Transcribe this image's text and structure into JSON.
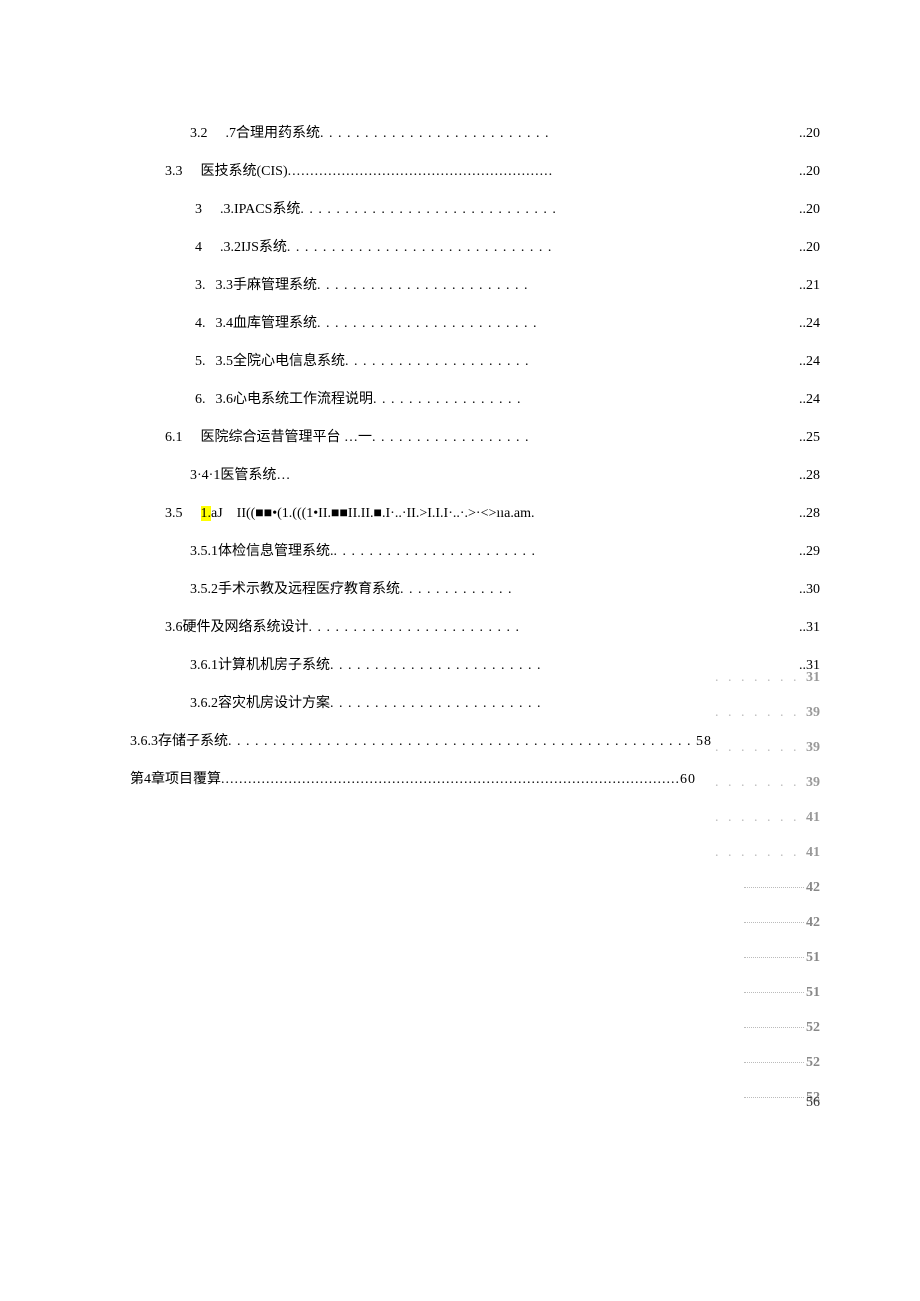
{
  "toc": [
    {
      "indent": "indent-2",
      "prefix": "3.2",
      "prefixClass": "gap-prefix-wide",
      "title": ".7合理用药系统",
      "dots": ". . . . . . . . . . . . . . . . . . . . . . . . . .",
      "page": "..20",
      "highlight": false
    },
    {
      "indent": "indent-1",
      "prefix": "3.3",
      "prefixClass": "gap-prefix-wide",
      "title": "医技系统(CIS)",
      "dots": "...........................................................",
      "page": "..20",
      "highlight": false
    },
    {
      "indent": "indent-2b",
      "prefix": "3",
      "prefixClass": "gap-prefix-wide",
      "title": ".3.IPACS系统 ",
      "dots": ". . . . . . . . . . . . . . . . . . . . . . . . . . . . .",
      "page": "..20",
      "highlight": false
    },
    {
      "indent": "indent-2b",
      "prefix": "4",
      "prefixClass": "gap-prefix-wide",
      "title": ".3.2IJS系统 ",
      "dots": ". . . . . . . . . . . . . . . . . . . . . . . . . . . . . .",
      "page": "..20",
      "highlight": false
    },
    {
      "indent": "indent-2b",
      "prefix": "3.",
      "prefixClass": "num-prefix",
      "title": "3.3手麻管理系统 ",
      "dots": ". . . . . . . . . . . . . . . . . . . . . . . .",
      "page": "..21",
      "highlight": false
    },
    {
      "indent": "indent-2b",
      "prefix": "4.",
      "prefixClass": "num-prefix",
      "title": "3.4血库管理系统 ",
      "dots": ". . . . . . . . . . . . . . . . . . . . . . . . .",
      "page": "..24",
      "highlight": false
    },
    {
      "indent": "indent-2b",
      "prefix": "5.",
      "prefixClass": "num-prefix",
      "title": "3.5全院心电信息系统 ",
      "dots": ". . . . . . . . . . . . . . . . . . . . .",
      "page": "..24",
      "highlight": false
    },
    {
      "indent": "indent-2b",
      "prefix": "6.",
      "prefixClass": "num-prefix",
      "title": "3.6心电系统工作流程说明 ",
      "dots": ". . . . . . . . . . . . . . . . .",
      "page": "..24",
      "highlight": false
    },
    {
      "indent": "indent-1",
      "prefix": "6.1",
      "prefixClass": "gap-prefix-wide",
      "title": "医院综合运昔管理平台 …一 ",
      "dots": ". . . . . . . . . .  . . . . . . . .",
      "page": "..25",
      "highlight": false
    },
    {
      "indent": "indent-2",
      "prefix": "",
      "prefixClass": "",
      "title": "3·4·1医管系统…",
      "dots": "",
      "page": "..28",
      "highlight": false
    },
    {
      "indent": "indent-1",
      "prefix": "3.5",
      "prefixClass": "gap-prefix-wide",
      "title": "aJ　II((■■•(1.(((1•II.■■II.II.■.I·..·II.>I.I.I·..·.>·<>ııa.am.",
      "dots": "",
      "page": "..28",
      "highlight": true,
      "highlightText": "1."
    },
    {
      "indent": "indent-2",
      "prefix": "",
      "prefixClass": "",
      "title": "3.5.1体检信息管理系统. ",
      "dots": ". . . . . . . . . . . . . . . .  . . . . . .  .",
      "page": "..29",
      "highlight": false
    },
    {
      "indent": "indent-2",
      "prefix": "",
      "prefixClass": "",
      "title": "3.5.2手术示教及远程医疗教育系统 ",
      "dots": ". . . . . . . . . . . . .",
      "page": "..30",
      "highlight": false
    },
    {
      "indent": "indent-1",
      "prefix": "",
      "prefixClass": "",
      "title": "3.6硬件及网络系统设计 ",
      "dots": ". . . . . . . . . . . . . . . . . . . . . . . .",
      "page": "..31",
      "highlight": false
    },
    {
      "indent": "indent-2",
      "prefix": "",
      "prefixClass": "",
      "title": "3.6.1计算机机房子系统 ",
      "dots": ". . . . . . . . . . . . . . . . . . . . . . . .",
      "page": "..31",
      "highlight": false
    },
    {
      "indent": "indent-2",
      "prefix": "",
      "prefixClass": "",
      "title": "3.6.2容灾机房设计方案 ",
      "dots": ". . . . . . . . . . . . . . . . . . . . . . . .",
      "page": "",
      "highlight": false
    },
    {
      "indent": "indent-0",
      "prefix": "",
      "prefixClass": "",
      "title": "3.6.3存储子系统 ",
      "dots": ". . . . . . . . . . . . . . . . . . . . . . . . . . . . . . . . . . . . . . . . . . . . . . . . . . . . 58",
      "page": "",
      "highlight": false
    },
    {
      "indent": "indent-0",
      "prefix": "",
      "prefixClass": "",
      "title": "第4章项目覆算 ",
      "dots": "......................................................................................................60",
      "page": "",
      "highlight": false
    }
  ],
  "rightColumn": [
    {
      "style": "dots",
      "page": "31"
    },
    {
      "style": "dots",
      "page": "39"
    },
    {
      "style": "dots",
      "page": "39"
    },
    {
      "style": "dots",
      "page": "39"
    },
    {
      "style": "dots",
      "page": "41"
    },
    {
      "style": "dots",
      "page": "41"
    },
    {
      "style": "dashed",
      "page": "42"
    },
    {
      "style": "dashed",
      "page": "42"
    },
    {
      "style": "dashed",
      "page": "51"
    },
    {
      "style": "dashed",
      "page": "51"
    },
    {
      "style": "dashed",
      "page": "52"
    },
    {
      "style": "dashed",
      "page": "52"
    },
    {
      "style": "dashed",
      "page": "52"
    }
  ],
  "footerPage": "56"
}
